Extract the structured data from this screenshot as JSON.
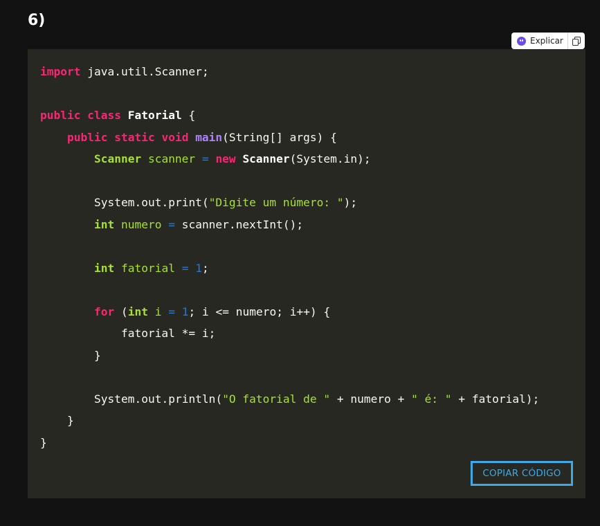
{
  "heading": "6)",
  "toolbar": {
    "explain_label": "Explicar",
    "explain_icon": "assistant-face-icon",
    "copy_icon": "copy-icon"
  },
  "code": {
    "language": "java",
    "lines": [
      "import java.util.Scanner;",
      "",
      "public class Fatorial {",
      "    public static void main(String[] args) {",
      "        Scanner scanner = new Scanner(System.in);",
      "",
      "        System.out.print(\"Digite um número: \");",
      "        int numero = scanner.nextInt();",
      "",
      "        int fatorial = 1;",
      "",
      "        for (int i = 1; i <= numero; i++) {",
      "            fatorial *= i;",
      "        }",
      "",
      "        System.out.println(\"O fatorial de \" + numero + \" é: \" + fatorial);",
      "    }",
      "}"
    ]
  },
  "copy_button": {
    "label": "COPIAR CÓDIGO"
  },
  "colors": {
    "page_bg": "#121212",
    "panel_bg": "#272822",
    "keyword": "#f92672",
    "type": "#a6e22e",
    "function": "#ae81ff",
    "number": "#1f7bd6",
    "button_accent": "#3fa9e6"
  }
}
